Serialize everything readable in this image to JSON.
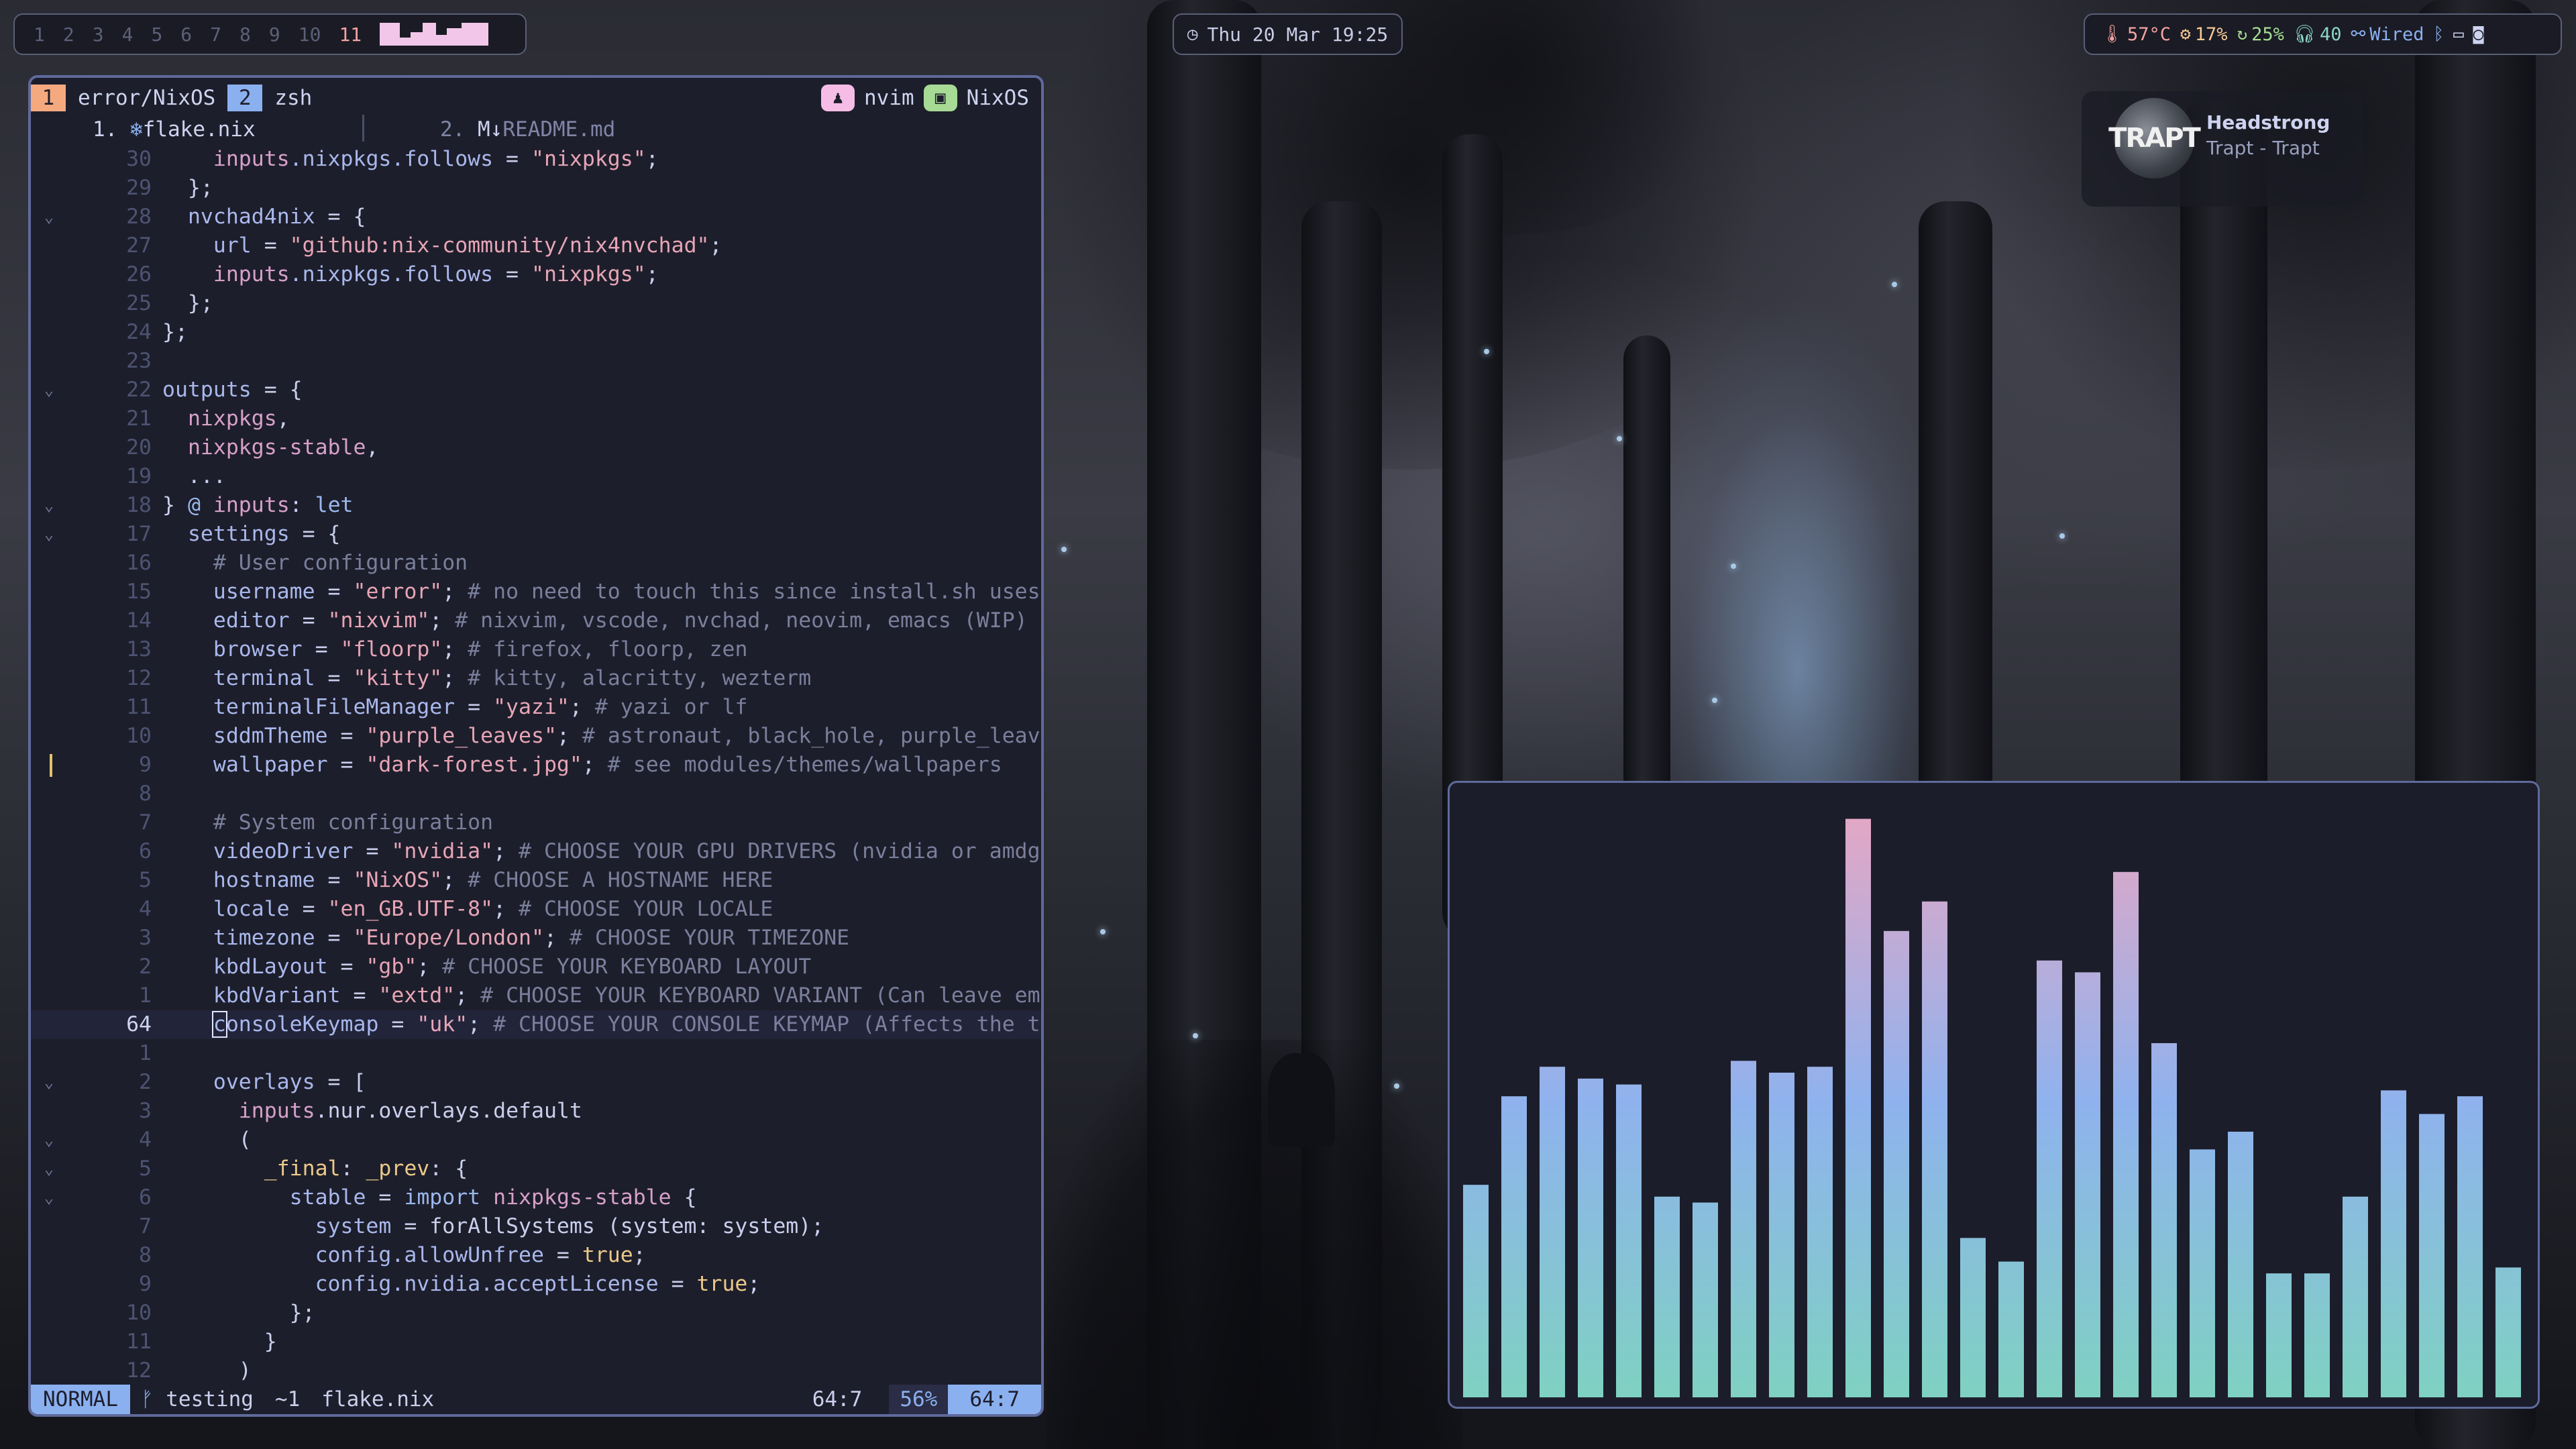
{
  "colors": {
    "accent_blue": "#8bb0f0",
    "accent_orange": "#f5a97f",
    "accent_pink": "#f2c6e8",
    "tmux_pink": "#f5bde6",
    "tmux_green": "#a6da95",
    "warn_red": "#f4a3a3",
    "green": "#a6da95",
    "viz_bottom": "#7fd1c2",
    "viz_mid": "#8fb2ee",
    "viz_top": "#e6a7c4"
  },
  "topbar": {
    "workspaces": [
      "1",
      "2",
      "3",
      "4",
      "5",
      "6",
      "7",
      "8",
      "9",
      "10",
      "11"
    ],
    "active_workspace": "11",
    "clock": "Thu 20 Mar 19:25",
    "status": {
      "temp": "57°C",
      "cpu": "17%",
      "memory": "25%",
      "volume": "40",
      "network": "Wired"
    }
  },
  "tmux": {
    "windows": [
      {
        "index": "1",
        "name": "error/NixOS"
      },
      {
        "index": "2",
        "name": "zsh"
      }
    ],
    "program": "nvim",
    "session": "NixOS"
  },
  "buffers": [
    {
      "label": "1.",
      "name": "flake.nix",
      "icon": "snowflake-icon"
    },
    {
      "label": "2.",
      "name": "README.md",
      "icon": "markdown-icon"
    }
  ],
  "editor": {
    "lines": [
      {
        "n": "30",
        "fold": "",
        "t": "    inputs.nixpkgs.follows = \"nixpkgs\";"
      },
      {
        "n": "29",
        "fold": "",
        "t": "  };"
      },
      {
        "n": "28",
        "fold": "v",
        "t": "  nvchad4nix = {"
      },
      {
        "n": "27",
        "fold": "",
        "t": "    url = \"github:nix-community/nix4nvchad\";"
      },
      {
        "n": "26",
        "fold": "",
        "t": "    inputs.nixpkgs.follows = \"nixpkgs\";"
      },
      {
        "n": "25",
        "fold": "",
        "t": "  };"
      },
      {
        "n": "24",
        "fold": "",
        "t": "};"
      },
      {
        "n": "23",
        "fold": "",
        "t": ""
      },
      {
        "n": "22",
        "fold": "v",
        "t": "outputs = {"
      },
      {
        "n": "21",
        "fold": "",
        "t": "  nixpkgs,"
      },
      {
        "n": "20",
        "fold": "",
        "t": "  nixpkgs-stable,"
      },
      {
        "n": "19",
        "fold": "",
        "t": "  ..."
      },
      {
        "n": "18",
        "fold": "v",
        "t": "} @ inputs: let"
      },
      {
        "n": "17",
        "fold": "v",
        "t": "  settings = {"
      },
      {
        "n": "16",
        "fold": "",
        "t": "    # User configuration"
      },
      {
        "n": "15",
        "fold": "",
        "t": "    username = \"error\"; # no need to touch this since install.sh uses"
      },
      {
        "n": "14",
        "fold": "",
        "t": "    editor = \"nixvim\"; # nixvim, vscode, nvchad, neovim, emacs (WIP)"
      },
      {
        "n": "13",
        "fold": "",
        "t": "    browser = \"floorp\"; # firefox, floorp, zen"
      },
      {
        "n": "12",
        "fold": "",
        "t": "    terminal = \"kitty\"; # kitty, alacritty, wezterm"
      },
      {
        "n": "11",
        "fold": "",
        "t": "    terminalFileManager = \"yazi\"; # yazi or lf"
      },
      {
        "n": "10",
        "fold": "",
        "t": "    sddmTheme = \"purple_leaves\"; # astronaut, black_hole, purple_leav"
      },
      {
        "n": "9",
        "fold": "",
        "t": "    wallpaper = \"dark-forest.jpg\"; # see modules/themes/wallpapers"
      },
      {
        "n": "8",
        "fold": "",
        "t": ""
      },
      {
        "n": "7",
        "fold": "",
        "t": "    # System configuration"
      },
      {
        "n": "6",
        "fold": "",
        "t": "    videoDriver = \"nvidia\"; # CHOOSE YOUR GPU DRIVERS (nvidia or amdg"
      },
      {
        "n": "5",
        "fold": "",
        "t": "    hostname = \"NixOS\"; # CHOOSE A HOSTNAME HERE"
      },
      {
        "n": "4",
        "fold": "",
        "t": "    locale = \"en_GB.UTF-8\"; # CHOOSE YOUR LOCALE"
      },
      {
        "n": "3",
        "fold": "",
        "t": "    timezone = \"Europe/London\"; # CHOOSE YOUR TIMEZONE"
      },
      {
        "n": "2",
        "fold": "",
        "t": "    kbdLayout = \"gb\"; # CHOOSE YOUR KEYBOARD LAYOUT"
      },
      {
        "n": "1",
        "fold": "",
        "t": "    kbdVariant = \"extd\"; # CHOOSE YOUR KEYBOARD VARIANT (Can leave em"
      },
      {
        "n": "64",
        "fold": "",
        "t": "    consoleKeymap = \"uk\"; # CHOOSE YOUR CONSOLE KEYMAP (Affects the t",
        "current": true
      },
      {
        "n": "1",
        "fold": "",
        "t": ""
      },
      {
        "n": "2",
        "fold": "v",
        "t": "    overlays = ["
      },
      {
        "n": "3",
        "fold": "",
        "t": "      inputs.nur.overlays.default"
      },
      {
        "n": "4",
        "fold": "v",
        "t": "      ("
      },
      {
        "n": "5",
        "fold": "v",
        "t": "        _final: _prev: {"
      },
      {
        "n": "6",
        "fold": "v",
        "t": "          stable = import nixpkgs-stable {"
      },
      {
        "n": "7",
        "fold": "",
        "t": "            system = forAllSystems (system: system);"
      },
      {
        "n": "8",
        "fold": "",
        "t": "            config.allowUnfree = true;"
      },
      {
        "n": "9",
        "fold": "",
        "t": "            config.nvidia.acceptLicense = true;"
      },
      {
        "n": "10",
        "fold": "",
        "t": "          };"
      },
      {
        "n": "11",
        "fold": "",
        "t": "        }"
      },
      {
        "n": "12",
        "fold": "",
        "t": "      )"
      }
    ]
  },
  "statusline": {
    "mode": "NORMAL",
    "branch": "testing",
    "changes": "~1",
    "file": "flake.nix",
    "position": "64:7",
    "percent": "56%",
    "position2": "64:7"
  },
  "music": {
    "cover_text": "TRAPT",
    "title": "Headstrong",
    "artist": "Trapt - Trapt"
  },
  "visualizer": {
    "levels": [
      0.36,
      0.51,
      0.56,
      0.54,
      0.53,
      0.34,
      0.33,
      0.57,
      0.55,
      0.56,
      0.98,
      0.79,
      0.84,
      0.27,
      0.23,
      0.74,
      0.72,
      0.89,
      0.6,
      0.42,
      0.45,
      0.21,
      0.21,
      0.34,
      0.52,
      0.48,
      0.51,
      0.22
    ]
  }
}
